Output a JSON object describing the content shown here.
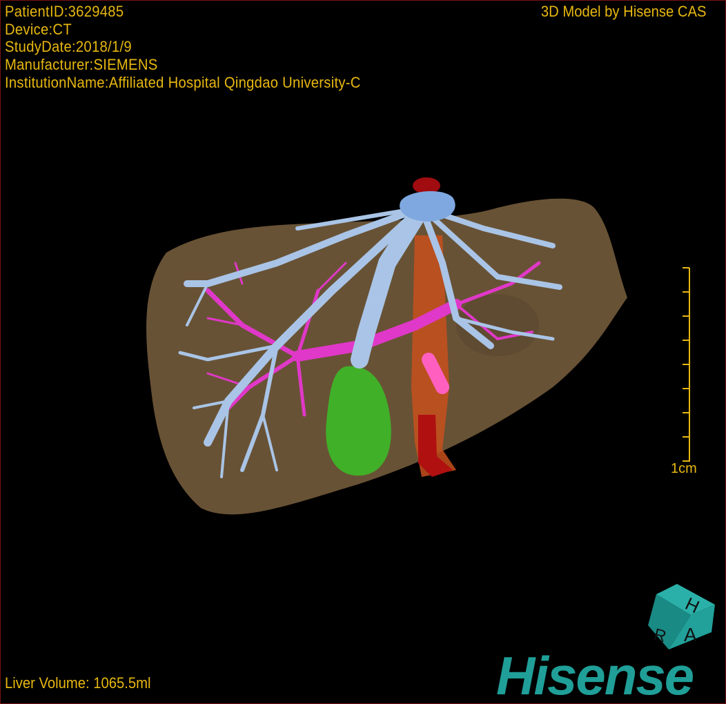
{
  "overlay": {
    "patient_id": "PatientID:3629485",
    "device": "Device:CT",
    "study_date": "StudyDate:2018/1/9",
    "manufacturer": "Manufacturer:SIEMENS",
    "institution": "InstitutionName:Affiliated Hospital Qingdao University-C",
    "credit": "3D Model by Hisense CAS",
    "liver_volume": "Liver Volume: 1065.5ml"
  },
  "scale_bar": {
    "label": "1cm",
    "ticks": 9
  },
  "orientation_cube": {
    "faces": [
      "H",
      "R",
      "A"
    ],
    "color": "#1f9f98"
  },
  "logo": {
    "text": "Hisense",
    "color": "#1f9f98"
  },
  "colors": {
    "text": "#e8b810",
    "liver": "#7a6040",
    "hepatic_vein": "#a9c4e6",
    "portal_vein": "#e040c8",
    "gallbladder": "#44b02a",
    "ivc": "#c01010",
    "border": "#7a1212"
  }
}
